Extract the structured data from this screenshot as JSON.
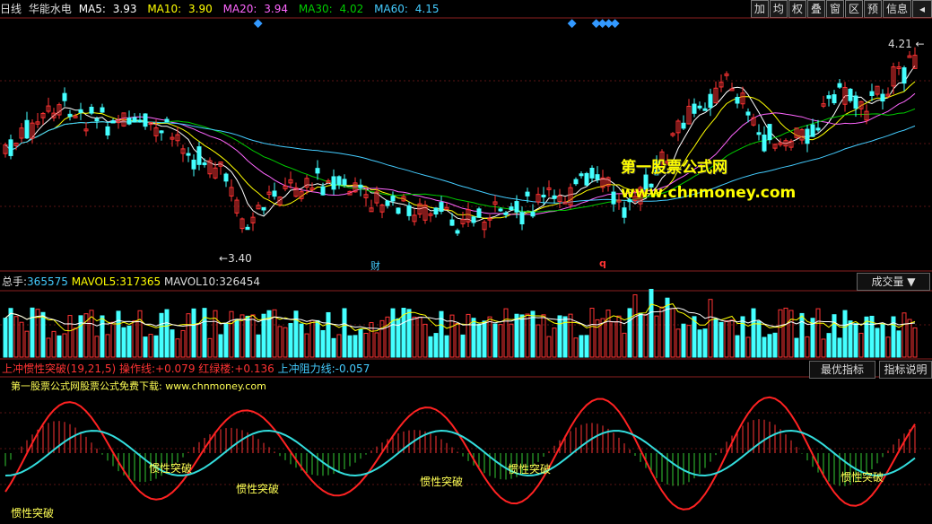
{
  "header": {
    "period": "日线",
    "stock_name": "华能水电",
    "ma5_label": "MA5:",
    "ma5_value": "3.93",
    "ma10_label": "MA10:",
    "ma10_value": "3.90",
    "ma20_label": "MA20:",
    "ma20_value": "3.94",
    "ma30_label": "MA30:",
    "ma30_value": "4.02",
    "ma60_label": "MA60:",
    "ma60_value": "4.15"
  },
  "toolbar": [
    "加",
    "均",
    "权",
    "叠",
    "窗",
    "区",
    "预",
    "信息"
  ],
  "toolbar_arrow": "◂",
  "colors": {
    "ma5": "#ffffff",
    "ma10": "#ffff00",
    "ma20": "#ff66ff",
    "ma30": "#00cc00",
    "ma60": "#44ccff",
    "up": "#ff3333",
    "down": "#44ffff"
  },
  "main_chart": {
    "high_label": "4.21",
    "low_label": "3.40",
    "event_cai": "财",
    "event_q": "q"
  },
  "watermark": {
    "title": "第一股票公式网",
    "url": "www.chnmoney.com"
  },
  "volume": {
    "label": "总手:",
    "value": "365575",
    "mavol5_label": "MAVOL5:",
    "mavol5_value": "317365",
    "mavol10_label": "MAVOL10:",
    "mavol10_value": "326454",
    "selector": "成交量"
  },
  "indicator": {
    "name": "上冲惯性突破(19,21,5)",
    "op_label": "操作线:",
    "op_value": "+0.079",
    "bar_label": "红绿楼:",
    "bar_value": "+0.136",
    "res_label": "上冲阻力线:",
    "res_value": "-0.057",
    "promo": "第一股票公式网股票公式免费下载: www.chnmoney.com",
    "best_button": "最优指标",
    "help_button": "指标说明",
    "signal_text": "惯性突破"
  }
}
